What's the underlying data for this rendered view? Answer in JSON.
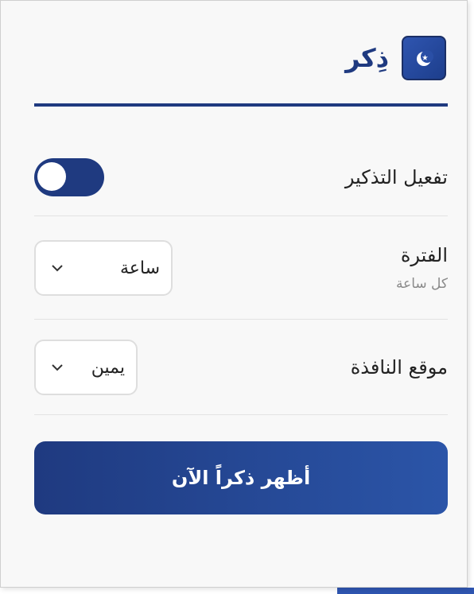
{
  "app": {
    "title": "ذِكر",
    "logo_icon": "crescent-star-icon",
    "brand_color": "#1f3a80"
  },
  "settings": {
    "reminder": {
      "label": "تفعيل التذكير",
      "enabled": true
    },
    "interval": {
      "label": "الفترة",
      "hint": "كل ساعة",
      "selected": "ساعة"
    },
    "position": {
      "label": "موقع النافذة",
      "selected": "يمين"
    }
  },
  "actions": {
    "show_now_label": "أظهر ذكراً الآن"
  }
}
